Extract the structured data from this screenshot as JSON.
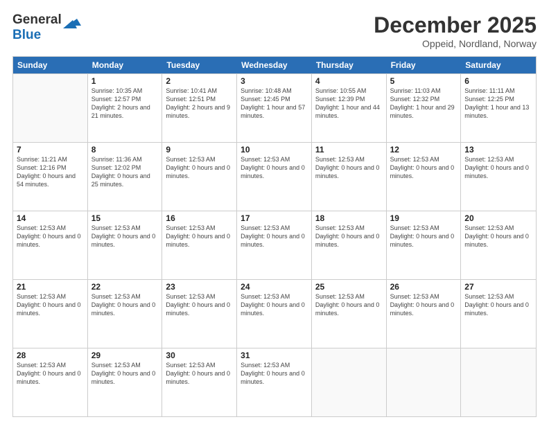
{
  "header": {
    "logo_line1": "General",
    "logo_line2": "Blue",
    "month": "December 2025",
    "location": "Oppeid, Nordland, Norway"
  },
  "day_headers": [
    "Sunday",
    "Monday",
    "Tuesday",
    "Wednesday",
    "Thursday",
    "Friday",
    "Saturday"
  ],
  "weeks": [
    [
      {
        "num": "",
        "info": ""
      },
      {
        "num": "1",
        "info": "Sunrise: 10:35 AM\nSunset: 12:57 PM\nDaylight: 2 hours and 21 minutes."
      },
      {
        "num": "2",
        "info": "Sunrise: 10:41 AM\nSunset: 12:51 PM\nDaylight: 2 hours and 9 minutes."
      },
      {
        "num": "3",
        "info": "Sunrise: 10:48 AM\nSunset: 12:45 PM\nDaylight: 1 hour and 57 minutes."
      },
      {
        "num": "4",
        "info": "Sunrise: 10:55 AM\nSunset: 12:39 PM\nDaylight: 1 hour and 44 minutes."
      },
      {
        "num": "5",
        "info": "Sunrise: 11:03 AM\nSunset: 12:32 PM\nDaylight: 1 hour and 29 minutes."
      },
      {
        "num": "6",
        "info": "Sunrise: 11:11 AM\nSunset: 12:25 PM\nDaylight: 1 hour and 13 minutes."
      }
    ],
    [
      {
        "num": "7",
        "info": "Sunrise: 11:21 AM\nSunset: 12:16 PM\nDaylight: 0 hours and 54 minutes."
      },
      {
        "num": "8",
        "info": "Sunrise: 11:36 AM\nSunset: 12:02 PM\nDaylight: 0 hours and 25 minutes."
      },
      {
        "num": "9",
        "info": "Sunset: 12:53 AM\nDaylight: 0 hours and 0 minutes."
      },
      {
        "num": "10",
        "info": "Sunset: 12:53 AM\nDaylight: 0 hours and 0 minutes."
      },
      {
        "num": "11",
        "info": "Sunset: 12:53 AM\nDaylight: 0 hours and 0 minutes."
      },
      {
        "num": "12",
        "info": "Sunset: 12:53 AM\nDaylight: 0 hours and 0 minutes."
      },
      {
        "num": "13",
        "info": "Sunset: 12:53 AM\nDaylight: 0 hours and 0 minutes."
      }
    ],
    [
      {
        "num": "14",
        "info": "Sunset: 12:53 AM\nDaylight: 0 hours and 0 minutes."
      },
      {
        "num": "15",
        "info": "Sunset: 12:53 AM\nDaylight: 0 hours and 0 minutes."
      },
      {
        "num": "16",
        "info": "Sunset: 12:53 AM\nDaylight: 0 hours and 0 minutes."
      },
      {
        "num": "17",
        "info": "Sunset: 12:53 AM\nDaylight: 0 hours and 0 minutes."
      },
      {
        "num": "18",
        "info": "Sunset: 12:53 AM\nDaylight: 0 hours and 0 minutes."
      },
      {
        "num": "19",
        "info": "Sunset: 12:53 AM\nDaylight: 0 hours and 0 minutes."
      },
      {
        "num": "20",
        "info": "Sunset: 12:53 AM\nDaylight: 0 hours and 0 minutes."
      }
    ],
    [
      {
        "num": "21",
        "info": "Sunset: 12:53 AM\nDaylight: 0 hours and 0 minutes."
      },
      {
        "num": "22",
        "info": "Sunset: 12:53 AM\nDaylight: 0 hours and 0 minutes."
      },
      {
        "num": "23",
        "info": "Sunset: 12:53 AM\nDaylight: 0 hours and 0 minutes."
      },
      {
        "num": "24",
        "info": "Sunset: 12:53 AM\nDaylight: 0 hours and 0 minutes."
      },
      {
        "num": "25",
        "info": "Sunset: 12:53 AM\nDaylight: 0 hours and 0 minutes."
      },
      {
        "num": "26",
        "info": "Sunset: 12:53 AM\nDaylight: 0 hours and 0 minutes."
      },
      {
        "num": "27",
        "info": "Sunset: 12:53 AM\nDaylight: 0 hours and 0 minutes."
      }
    ],
    [
      {
        "num": "28",
        "info": "Sunset: 12:53 AM\nDaylight: 0 hours and 0 minutes."
      },
      {
        "num": "29",
        "info": "Sunset: 12:53 AM\nDaylight: 0 hours and 0 minutes."
      },
      {
        "num": "30",
        "info": "Sunset: 12:53 AM\nDaylight: 0 hours and 0 minutes."
      },
      {
        "num": "31",
        "info": "Sunset: 12:53 AM\nDaylight: 0 hours and 0 minutes."
      },
      {
        "num": "",
        "info": ""
      },
      {
        "num": "",
        "info": ""
      },
      {
        "num": "",
        "info": ""
      }
    ]
  ]
}
